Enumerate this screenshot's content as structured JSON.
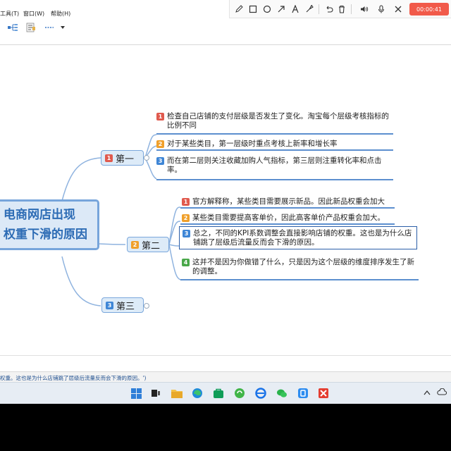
{
  "menu": {
    "tools": "工具(T)",
    "window": "窗口(W)",
    "help": "帮助(H)"
  },
  "recorder": {
    "timer": "00:00:41",
    "tools": [
      "pen-icon",
      "rectangle-icon",
      "circle-icon",
      "arrow-icon",
      "text-icon",
      "highlighter-icon",
      "undo-icon",
      "trash-icon",
      "speaker-icon",
      "microphone-icon",
      "close-icon"
    ]
  },
  "mindmap": {
    "central_line1": "电商网店出现",
    "central_line2": "权重下滑的原因",
    "topics": [
      {
        "label": "第一",
        "badge": "1",
        "subs": [
          {
            "badge": "1",
            "text": "检查自己店铺的支付层级是否发生了变化。淘宝每个层级考核指标的比例不同"
          },
          {
            "badge": "2",
            "text": "对于某些类目，第一层级时重点考核上新率和增长率"
          },
          {
            "badge": "3",
            "text": "而在第二层则关注收藏加购人气指标，第三层则注重转化率和点击率。"
          }
        ]
      },
      {
        "label": "第二",
        "badge": "2",
        "subs": [
          {
            "badge": "1",
            "text": "官方解释称，某些类目需要展示新品。因此新品权重会加大"
          },
          {
            "badge": "2",
            "text": "某些类目需要提高客单价，因此高客单价产品权重会加大。"
          },
          {
            "badge": "3",
            "text": "总之，不同的KPI系数调整会直接影响店铺的权重。这也是为什么店铺跳了层级后流量反而会下滑的原因。"
          },
          {
            "badge": "4",
            "text": "这并不是因为你做错了什么，只是因为这个层级的维度排序发生了新的调整。"
          }
        ]
      },
      {
        "label": "第三",
        "badge": "3",
        "subs": []
      }
    ]
  },
  "status": {
    "text": "权重。这也是为什么店铺跳了层级后流量反而会下滑的原因。')"
  },
  "colors": {
    "accent": "#3f86d6",
    "topic_bg": "#ddebf8",
    "central_text": "#2d6cb5",
    "timer_bg": "#f15a4a"
  }
}
